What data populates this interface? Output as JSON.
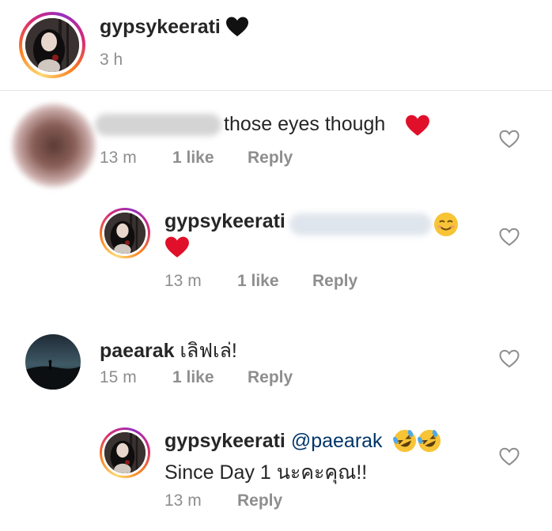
{
  "post": {
    "username": "gypsykeerati",
    "username_emoji": "black-heart-icon",
    "time": "3 h"
  },
  "comments": [
    {
      "username": "",
      "text": "those eyes though",
      "emoji": "red-heart-icon",
      "time": "13 m",
      "likes": "1 like",
      "reply": "Reply",
      "blurred": true
    },
    {
      "username": "gypsykeerati",
      "mention_blurred": true,
      "emoji": "smiling-face-icon",
      "emoji2": "red-heart-icon",
      "time": "13 m",
      "likes": "1 like",
      "reply": "Reply"
    },
    {
      "username": "paearak",
      "text": "เลิฟเล่!",
      "time": "15 m",
      "likes": "1 like",
      "reply": "Reply"
    },
    {
      "username": "gypsykeerati",
      "mention": "@paearak",
      "emoji": "rolling-laughing-face-icon",
      "line2": "Since Day 1 นะคะคุณ!!",
      "time": "13 m",
      "reply": "Reply"
    }
  ],
  "colors": {
    "meta_gray": "#8e8e8e",
    "text": "#262626",
    "mention": "#003569",
    "heart_red": "#e0102a"
  }
}
